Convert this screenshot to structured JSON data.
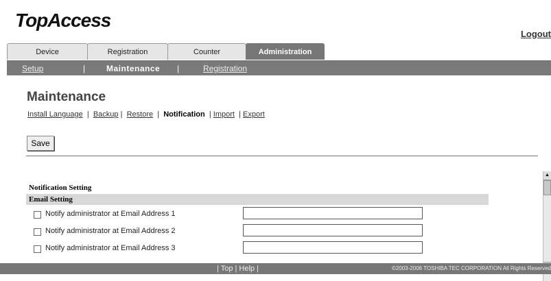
{
  "app": {
    "logo": "TopAccess",
    "logout": "Logout"
  },
  "tabs": [
    {
      "label": "Device"
    },
    {
      "label": "Registration"
    },
    {
      "label": "Counter"
    },
    {
      "label": "Administration"
    }
  ],
  "subnav": {
    "setup": "Setup",
    "sep1": "|",
    "maintenance": "Maintenance",
    "sep2": "|",
    "registration": "Registration"
  },
  "page": {
    "title": "Maintenance",
    "save": "Save"
  },
  "menu": {
    "install_language": "Install Language",
    "backup": "Backup",
    "restore": "Restore",
    "notification": "Notification",
    "import": "Import",
    "export": "Export",
    "sep": "|"
  },
  "section": {
    "title": "Notification Setting",
    "subheader": "Email Setting",
    "rows": [
      {
        "label": "Notify administrator at Email Address 1",
        "value": ""
      },
      {
        "label": "Notify administrator at Email Address 2",
        "value": ""
      },
      {
        "label": "Notify administrator at Email Address 3",
        "value": ""
      }
    ]
  },
  "footer": {
    "links": "| Top | Help |",
    "copyright": "©2003-2006 TOSHIBA TEC CORPORATION All Rights Reserved"
  }
}
